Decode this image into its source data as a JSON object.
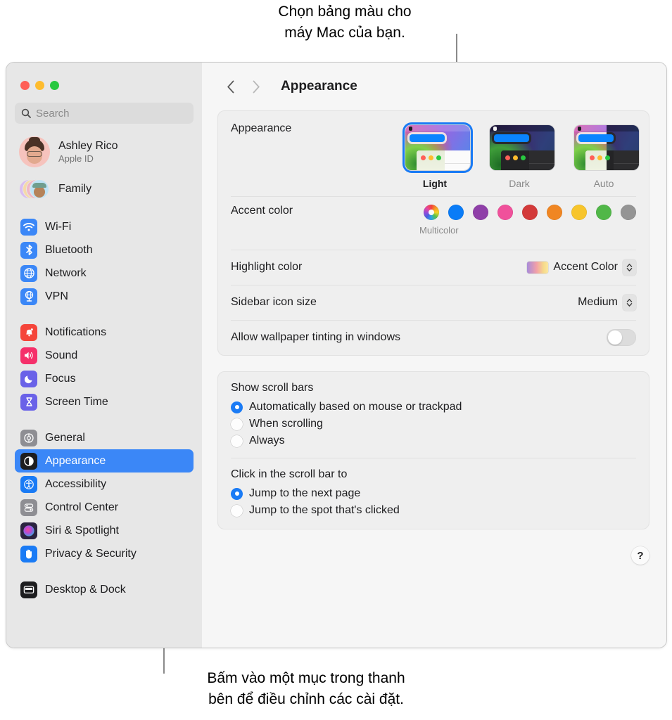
{
  "annotations": {
    "top": "Chọn bảng màu cho\nmáy Mac của bạn.",
    "bottom": "Bấm vào một mục trong thanh\nbên để điều chỉnh các cài đặt."
  },
  "window": {
    "toolbar": {
      "back_icon": "chevron-left-icon",
      "forward_icon": "chevron-right-icon",
      "title": "Appearance"
    }
  },
  "sidebar": {
    "search": {
      "placeholder": "Search",
      "value": "",
      "icon": "search-icon"
    },
    "account": {
      "name": "Ashley Rico",
      "subtitle": "Apple ID",
      "avatar": "memoji-avatar"
    },
    "family": {
      "label": "Family",
      "avatar": "family-avatars"
    },
    "groups": [
      {
        "items": [
          {
            "label": "Wi-Fi",
            "icon": "wifi-icon",
            "color": "#3b87f7",
            "selected": false
          },
          {
            "label": "Bluetooth",
            "icon": "bluetooth-icon",
            "color": "#3b87f7",
            "selected": false
          },
          {
            "label": "Network",
            "icon": "globe-icon",
            "color": "#3b87f7",
            "selected": false
          },
          {
            "label": "VPN",
            "icon": "vpn-icon",
            "color": "#3b87f7",
            "selected": false
          }
        ]
      },
      {
        "items": [
          {
            "label": "Notifications",
            "icon": "bell-icon",
            "color": "#f5453a",
            "selected": false
          },
          {
            "label": "Sound",
            "icon": "speaker-icon",
            "color": "#f5306a",
            "selected": false
          },
          {
            "label": "Focus",
            "icon": "moon-icon",
            "color": "#6a62e8",
            "selected": false
          },
          {
            "label": "Screen Time",
            "icon": "hourglass-icon",
            "color": "#6a62e8",
            "selected": false
          }
        ]
      },
      {
        "items": [
          {
            "label": "General",
            "icon": "gear-icon",
            "color": "#8e8e93",
            "selected": false
          },
          {
            "label": "Appearance",
            "icon": "appearance-icon",
            "color": "#1d1d1f",
            "selected": true
          },
          {
            "label": "Accessibility",
            "icon": "accessibility-icon",
            "color": "#1a7bf5",
            "selected": false
          },
          {
            "label": "Control Center",
            "icon": "control-center-icon",
            "color": "#8e8e93",
            "selected": false
          },
          {
            "label": "Siri & Spotlight",
            "icon": "siri-icon",
            "color": "#2b2340",
            "selected": false
          },
          {
            "label": "Privacy & Security",
            "icon": "hand-icon",
            "color": "#1a7bf5",
            "selected": false
          }
        ]
      },
      {
        "items": [
          {
            "label": "Desktop & Dock",
            "icon": "desktop-dock-icon",
            "color": "#1d1d1f",
            "selected": false
          }
        ]
      }
    ]
  },
  "main": {
    "appearance": {
      "label": "Appearance",
      "options": [
        {
          "label": "Light",
          "selected": true
        },
        {
          "label": "Dark",
          "selected": false
        },
        {
          "label": "Auto",
          "selected": false
        }
      ]
    },
    "accent": {
      "label": "Accent color",
      "caption": "Multicolor",
      "swatches": [
        {
          "name": "multicolor",
          "color": "multicolor",
          "selected": true
        },
        {
          "name": "blue",
          "color": "#0a7cf7"
        },
        {
          "name": "purple",
          "color": "#8f3fa8"
        },
        {
          "name": "pink",
          "color": "#f0519b"
        },
        {
          "name": "red",
          "color": "#d33a3a"
        },
        {
          "name": "orange",
          "color": "#f08622"
        },
        {
          "name": "yellow",
          "color": "#f7c52c"
        },
        {
          "name": "green",
          "color": "#51b748"
        },
        {
          "name": "graphite",
          "color": "#949494"
        }
      ]
    },
    "highlight": {
      "label": "Highlight color",
      "value": "Accent Color"
    },
    "sidebar_icon_size": {
      "label": "Sidebar icon size",
      "value": "Medium"
    },
    "wallpaper_tinting": {
      "label": "Allow wallpaper tinting in windows",
      "value": "off"
    },
    "show_scroll_bars": {
      "title": "Show scroll bars",
      "options": [
        {
          "label": "Automatically based on mouse or trackpad",
          "selected": true
        },
        {
          "label": "When scrolling",
          "selected": false
        },
        {
          "label": "Always",
          "selected": false
        }
      ]
    },
    "click_scroll_bar": {
      "title": "Click in the scroll bar to",
      "options": [
        {
          "label": "Jump to the next page",
          "selected": true
        },
        {
          "label": "Jump to the spot that's clicked",
          "selected": false
        }
      ]
    },
    "help": {
      "label": "?"
    }
  }
}
